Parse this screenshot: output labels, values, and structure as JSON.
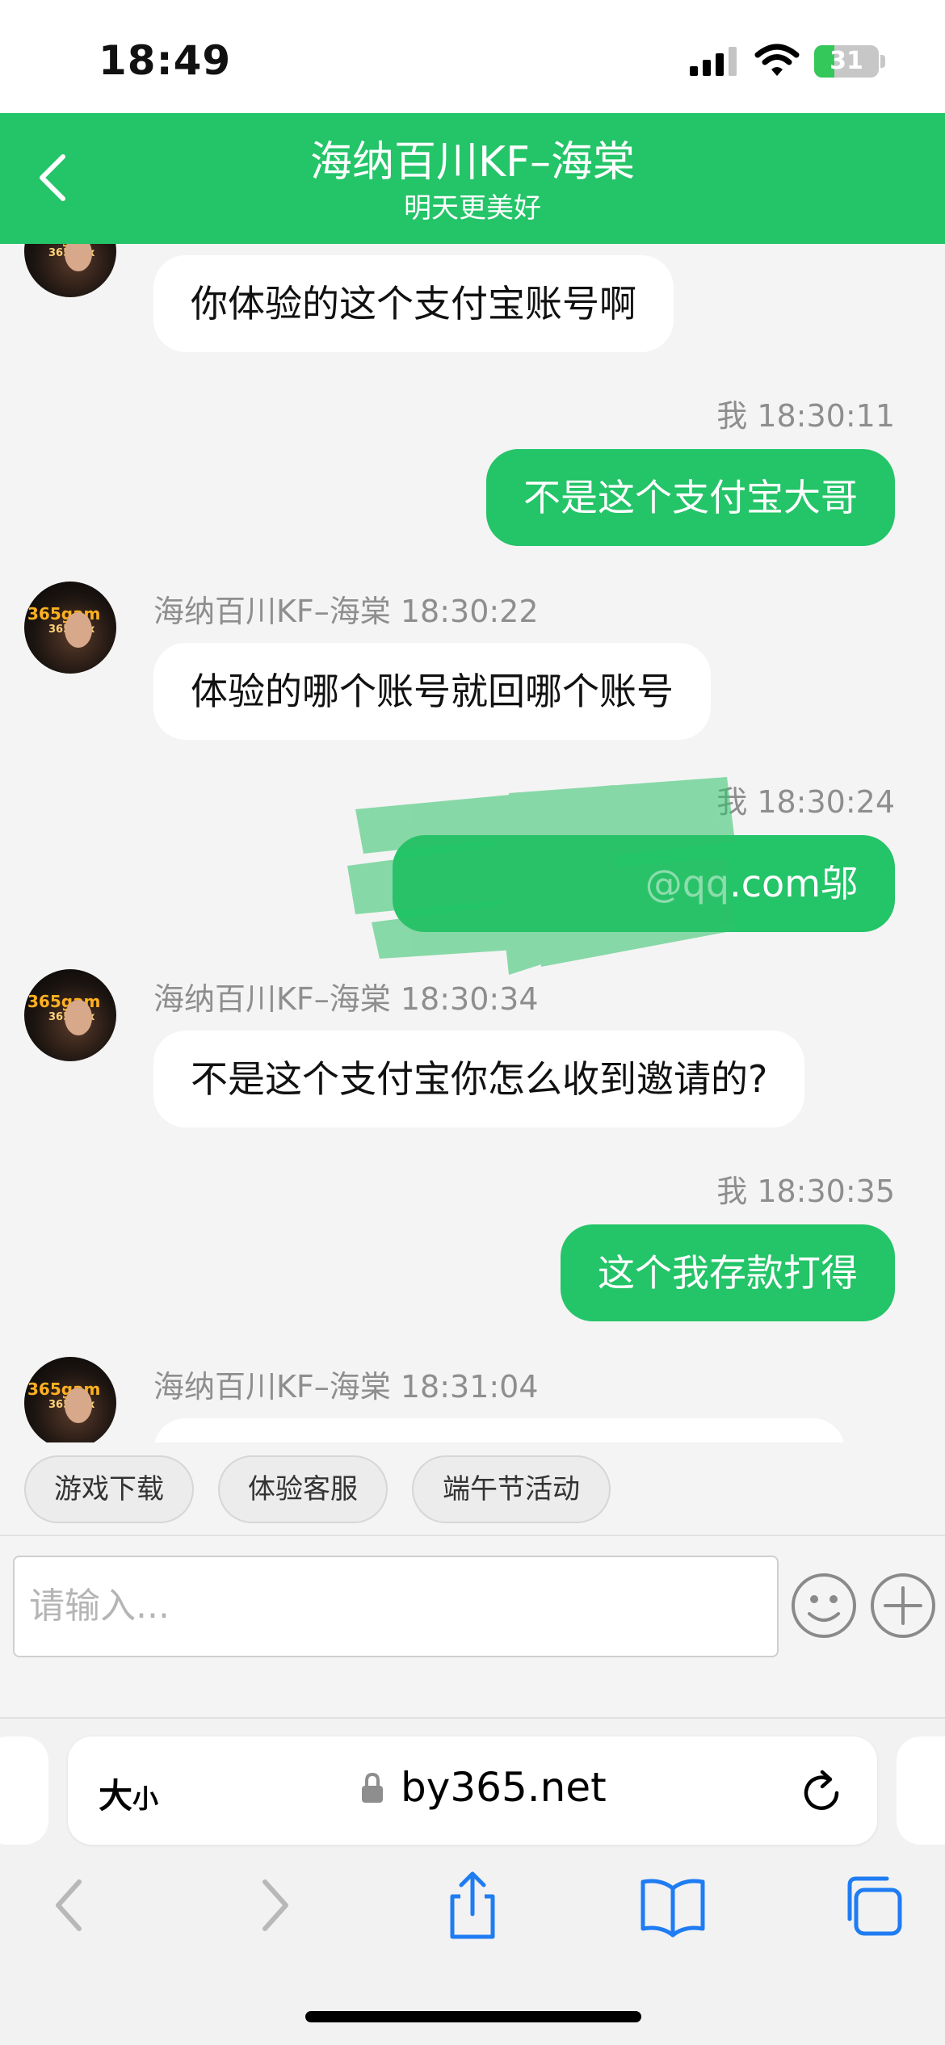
{
  "status": {
    "time": "18:49",
    "battery": "31",
    "battery_level": 0.31
  },
  "header": {
    "title": "海纳百川KF–海棠",
    "subtitle": "明天更美好"
  },
  "avatar": {
    "brand": "365gam",
    "brand_sub": "365.xxx"
  },
  "messages": [
    {
      "text": "你体验的这个支付宝账号啊"
    },
    {
      "meta": "我 18:30:11",
      "text": "不是这个支付宝大哥"
    },
    {
      "meta": "海纳百川KF–海棠 18:30:22",
      "text": "体验的哪个账号就回哪个账号"
    },
    {
      "meta": "我 18:30:24",
      "text": "@qq.com邬"
    },
    {
      "meta": "海纳百川KF–海棠 18:30:34",
      "text": "不是这个支付宝你怎么收到邀请的?"
    },
    {
      "meta": "我 18:30:35",
      "text": "这个我存款打得"
    },
    {
      "meta": "海纳百川KF–海棠 18:31:04"
    }
  ],
  "quick_replies": [
    "游戏下载",
    "体验客服",
    "端午节活动"
  ],
  "input": {
    "placeholder": "请输入..."
  },
  "browser": {
    "text_size_big": "大",
    "text_size_small": "小",
    "url": "by365.net"
  },
  "colors": {
    "accent": "#24c468",
    "bubble_in": "#ffffff",
    "background": "#f4f4f4"
  }
}
